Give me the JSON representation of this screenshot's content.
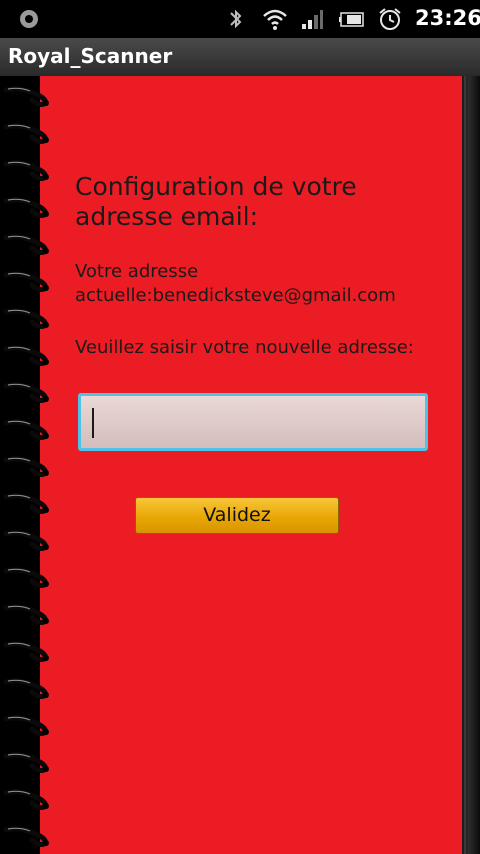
{
  "status_bar": {
    "time": "23:26",
    "icons": [
      "notification-icon",
      "bluetooth-icon",
      "wifi-icon",
      "signal-icon",
      "battery-icon",
      "alarm-icon"
    ]
  },
  "app": {
    "title": "Royal_Scanner"
  },
  "form": {
    "heading": "Configuration de votre adresse email:",
    "current_address": "Votre adresse actuelle:benedicksteve@gmail.com",
    "prompt": "Veuillez saisir votre nouvelle adresse:",
    "email_value": "",
    "validate_label": "Validez"
  },
  "colors": {
    "page_red": "#ec1c24",
    "input_border": "#4fc2e8",
    "button_gold": "#e9a705"
  }
}
